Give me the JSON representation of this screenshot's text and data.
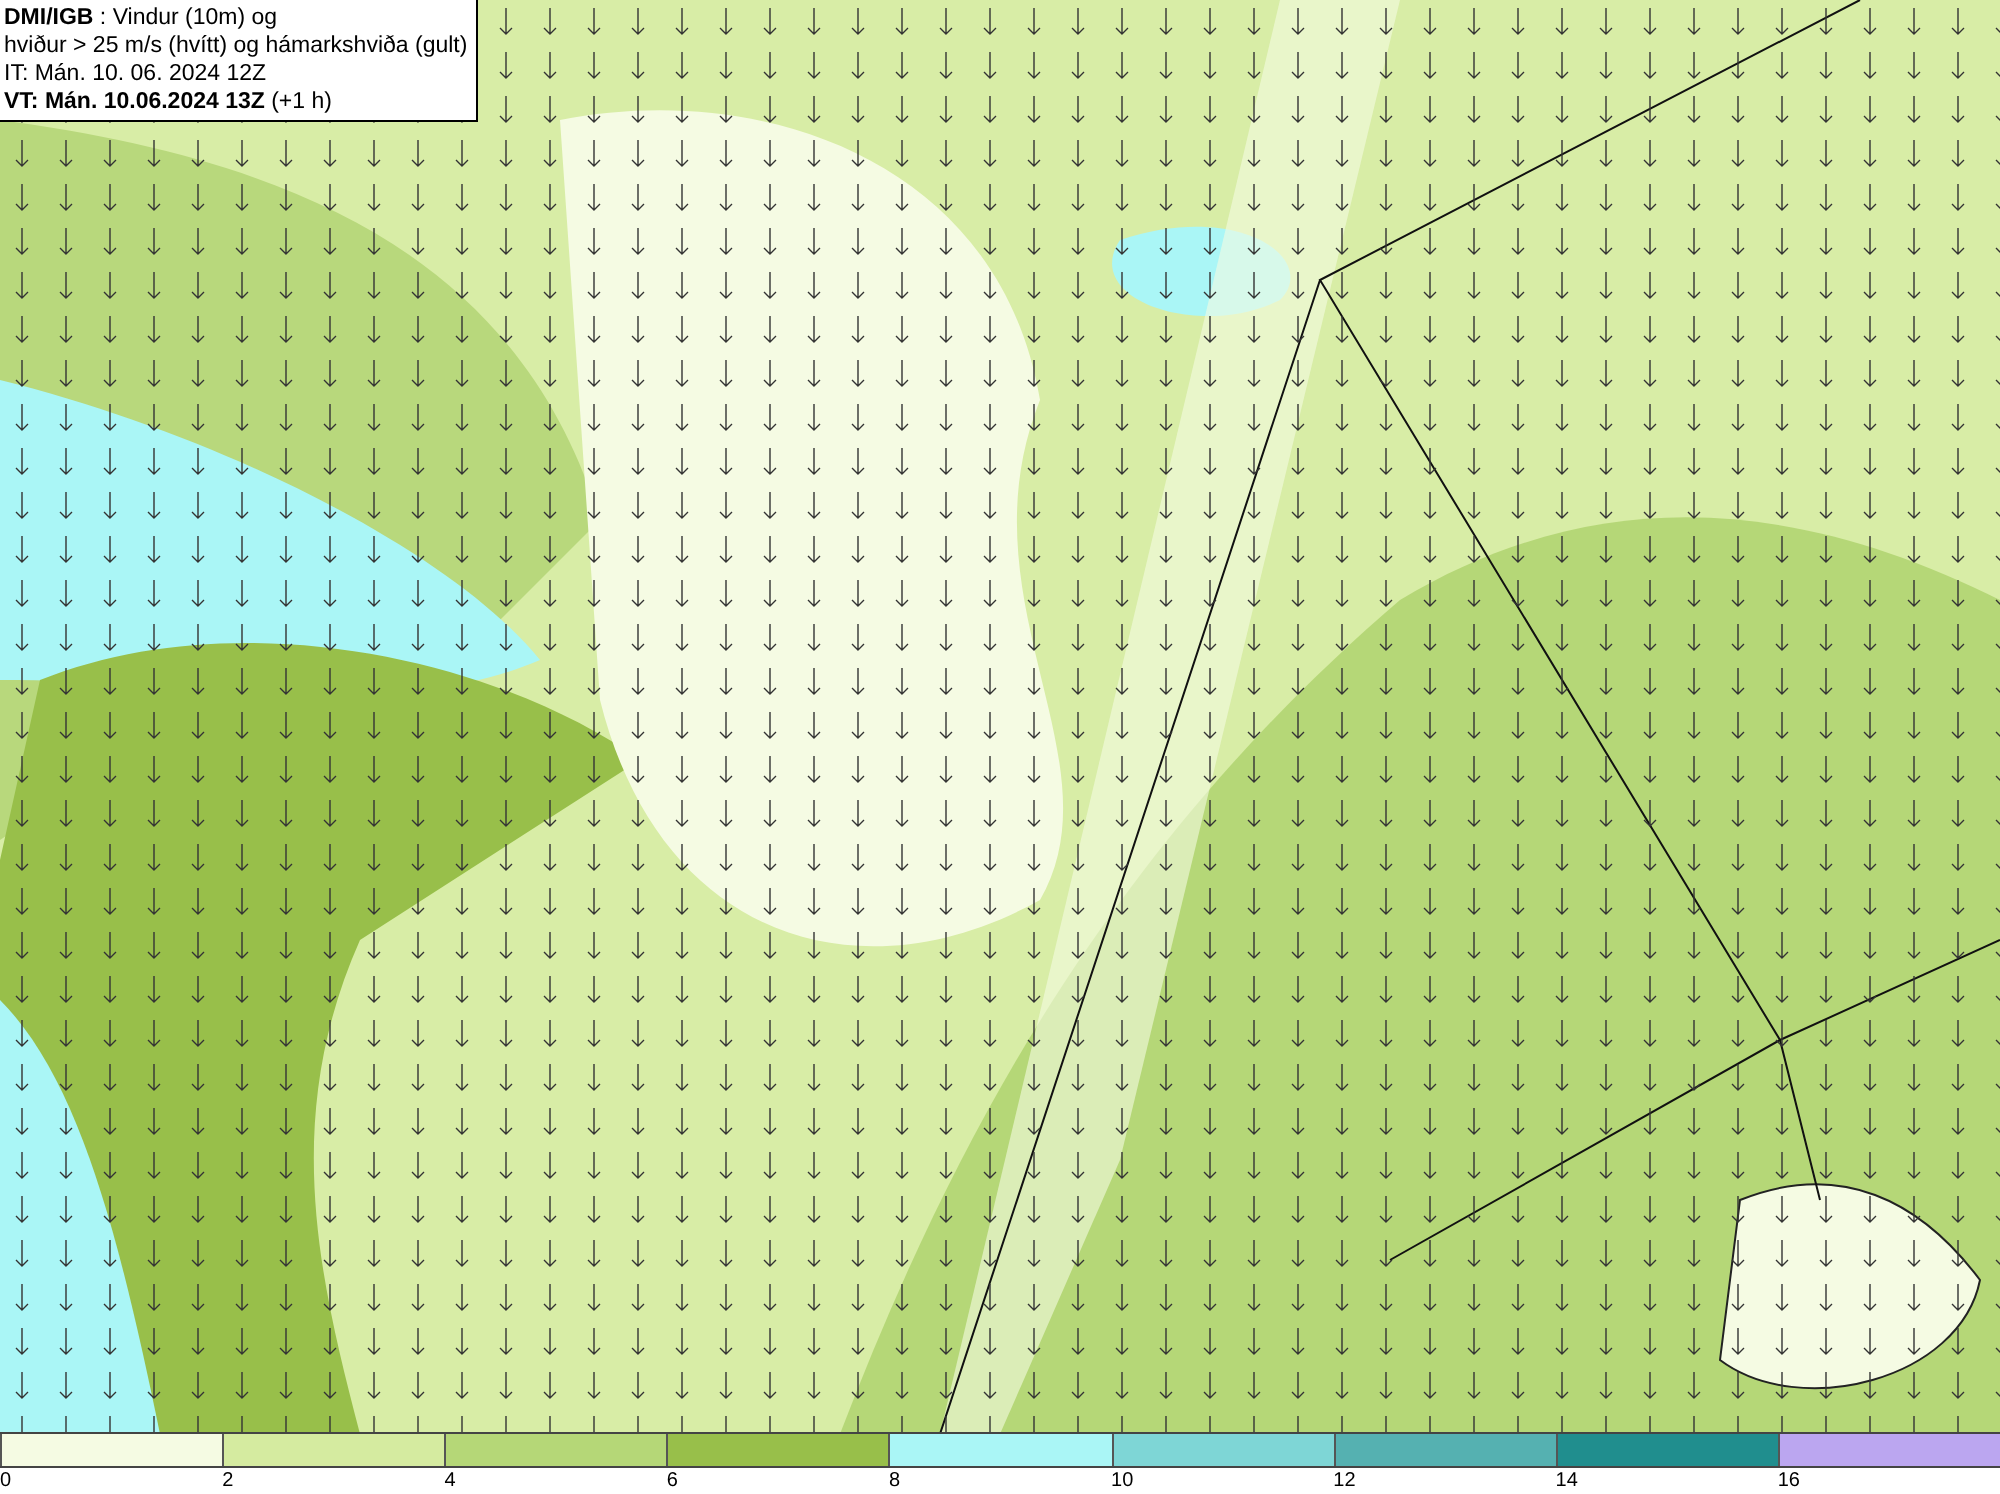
{
  "title_box": {
    "lines": [
      "**DMI/IGB** : Vindur (10m) og",
      "hviður > 25 m/s (hvítt) og hámarkshviða (gult)",
      "IT: Mán. 10. 06. 2024 12Z",
      "**VT: Mán. 10.06.2024 13Z** (+1 h)"
    ]
  },
  "legend": {
    "bins": [
      {
        "color": "#f5fbe3",
        "tick": "0"
      },
      {
        "color": "#d5eba0",
        "tick": "2"
      },
      {
        "color": "#b5d777",
        "tick": "4"
      },
      {
        "color": "#98bf4a",
        "tick": "6"
      },
      {
        "color": "#aaf6f6",
        "tick": "8"
      },
      {
        "color": "#7ed6d6",
        "tick": "10"
      },
      {
        "color": "#55b1b1",
        "tick": "12"
      },
      {
        "color": "#208e8e",
        "tick": "14"
      },
      {
        "color": "#bba6f0",
        "tick": "16"
      }
    ]
  }
}
